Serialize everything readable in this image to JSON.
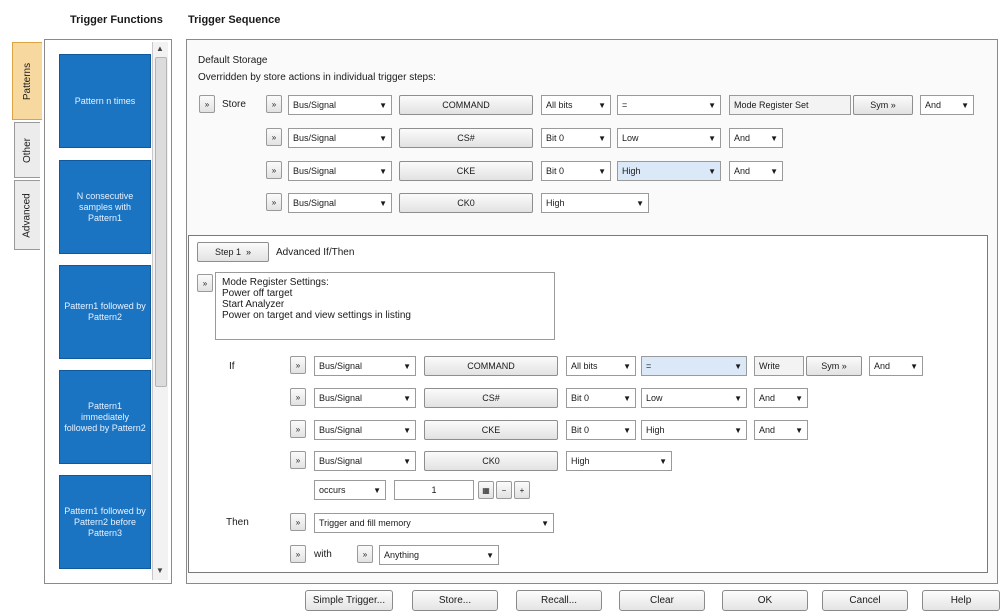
{
  "headers": {
    "functions": "Trigger Functions",
    "sequence": "Trigger Sequence"
  },
  "tabs": [
    "Patterns",
    "Other",
    "Advanced"
  ],
  "functions": [
    "Pattern n times",
    "N consecutive samples with Pattern1",
    "Pattern1 followed by Pattern2",
    "Pattern1 immediately followed by Pattern2",
    "Pattern1 followed by Pattern2 before Pattern3"
  ],
  "default_storage": {
    "title": "Default Storage",
    "subtitle": "Overridden by store actions in individual trigger steps:",
    "store_label": "Store",
    "rows": [
      {
        "type": "Bus/Signal",
        "signal": "COMMAND",
        "bits": "All bits",
        "op": "=",
        "value": "Mode Register Set",
        "sym": "Sym",
        "logic": "And"
      },
      {
        "type": "Bus/Signal",
        "signal": "CS#",
        "bits": "Bit 0",
        "op": "Low",
        "logic": "And"
      },
      {
        "type": "Bus/Signal",
        "signal": "CKE",
        "bits": "Bit 0",
        "op": "High",
        "logic": "And"
      },
      {
        "type": "Bus/Signal",
        "signal": "CK0",
        "bits": "High"
      }
    ]
  },
  "step": {
    "label": "Step 1",
    "mode": "Advanced If/Then",
    "description": [
      "Mode Register Settings:",
      "Power off target",
      "Start Analyzer",
      "Power on target and view settings in listing"
    ],
    "if_label": "If",
    "rows": [
      {
        "type": "Bus/Signal",
        "signal": "COMMAND",
        "bits": "All bits",
        "op": "=",
        "value": "Write",
        "sym": "Sym",
        "logic": "And"
      },
      {
        "type": "Bus/Signal",
        "signal": "CS#",
        "bits": "Bit 0",
        "op": "Low",
        "logic": "And"
      },
      {
        "type": "Bus/Signal",
        "signal": "CKE",
        "bits": "Bit 0",
        "op": "High",
        "logic": "And"
      },
      {
        "type": "Bus/Signal",
        "signal": "CK0",
        "bits": "High"
      }
    ],
    "occurs": "occurs",
    "count": "1",
    "then_label": "Then",
    "action": "Trigger and fill memory",
    "with_label": "with",
    "with_value": "Anything"
  },
  "buttons": [
    "Simple Trigger...",
    "Store...",
    "Recall...",
    "Clear",
    "OK",
    "Cancel",
    "Help"
  ]
}
